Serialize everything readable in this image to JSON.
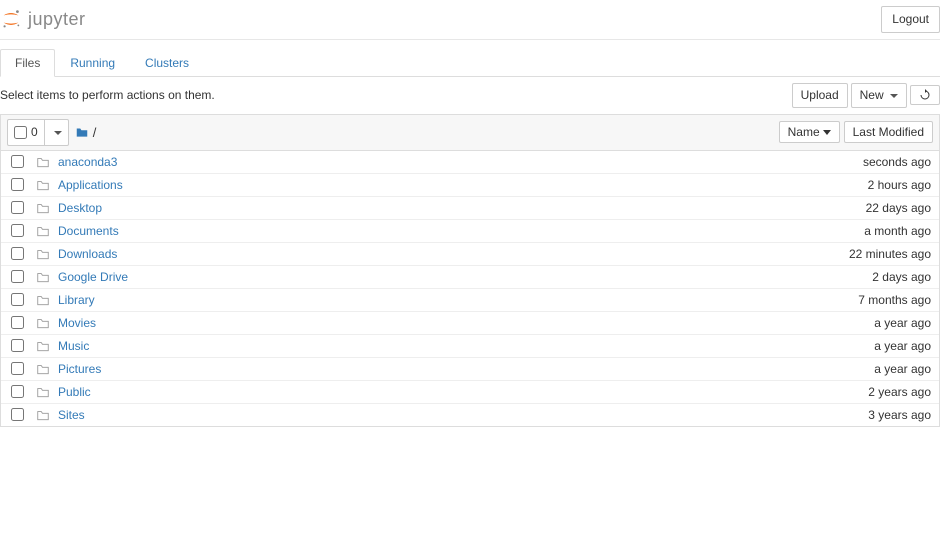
{
  "header": {
    "brand": "jupyter",
    "logout": "Logout"
  },
  "tabs": {
    "files": "Files",
    "running": "Running",
    "clusters": "Clusters"
  },
  "toolbar": {
    "hint": "Select items to perform actions on them.",
    "upload": "Upload",
    "new": "New",
    "selected_count": "0",
    "breadcrumb_sep": "/"
  },
  "sort": {
    "name": "Name",
    "modified": "Last Modified"
  },
  "files": [
    {
      "name": "anaconda3",
      "modified": "seconds ago"
    },
    {
      "name": "Applications",
      "modified": "2 hours ago"
    },
    {
      "name": "Desktop",
      "modified": "22 days ago"
    },
    {
      "name": "Documents",
      "modified": "a month ago"
    },
    {
      "name": "Downloads",
      "modified": "22 minutes ago"
    },
    {
      "name": "Google Drive",
      "modified": "2 days ago"
    },
    {
      "name": "Library",
      "modified": "7 months ago"
    },
    {
      "name": "Movies",
      "modified": "a year ago"
    },
    {
      "name": "Music",
      "modified": "a year ago"
    },
    {
      "name": "Pictures",
      "modified": "a year ago"
    },
    {
      "name": "Public",
      "modified": "2 years ago"
    },
    {
      "name": "Sites",
      "modified": "3 years ago"
    }
  ]
}
